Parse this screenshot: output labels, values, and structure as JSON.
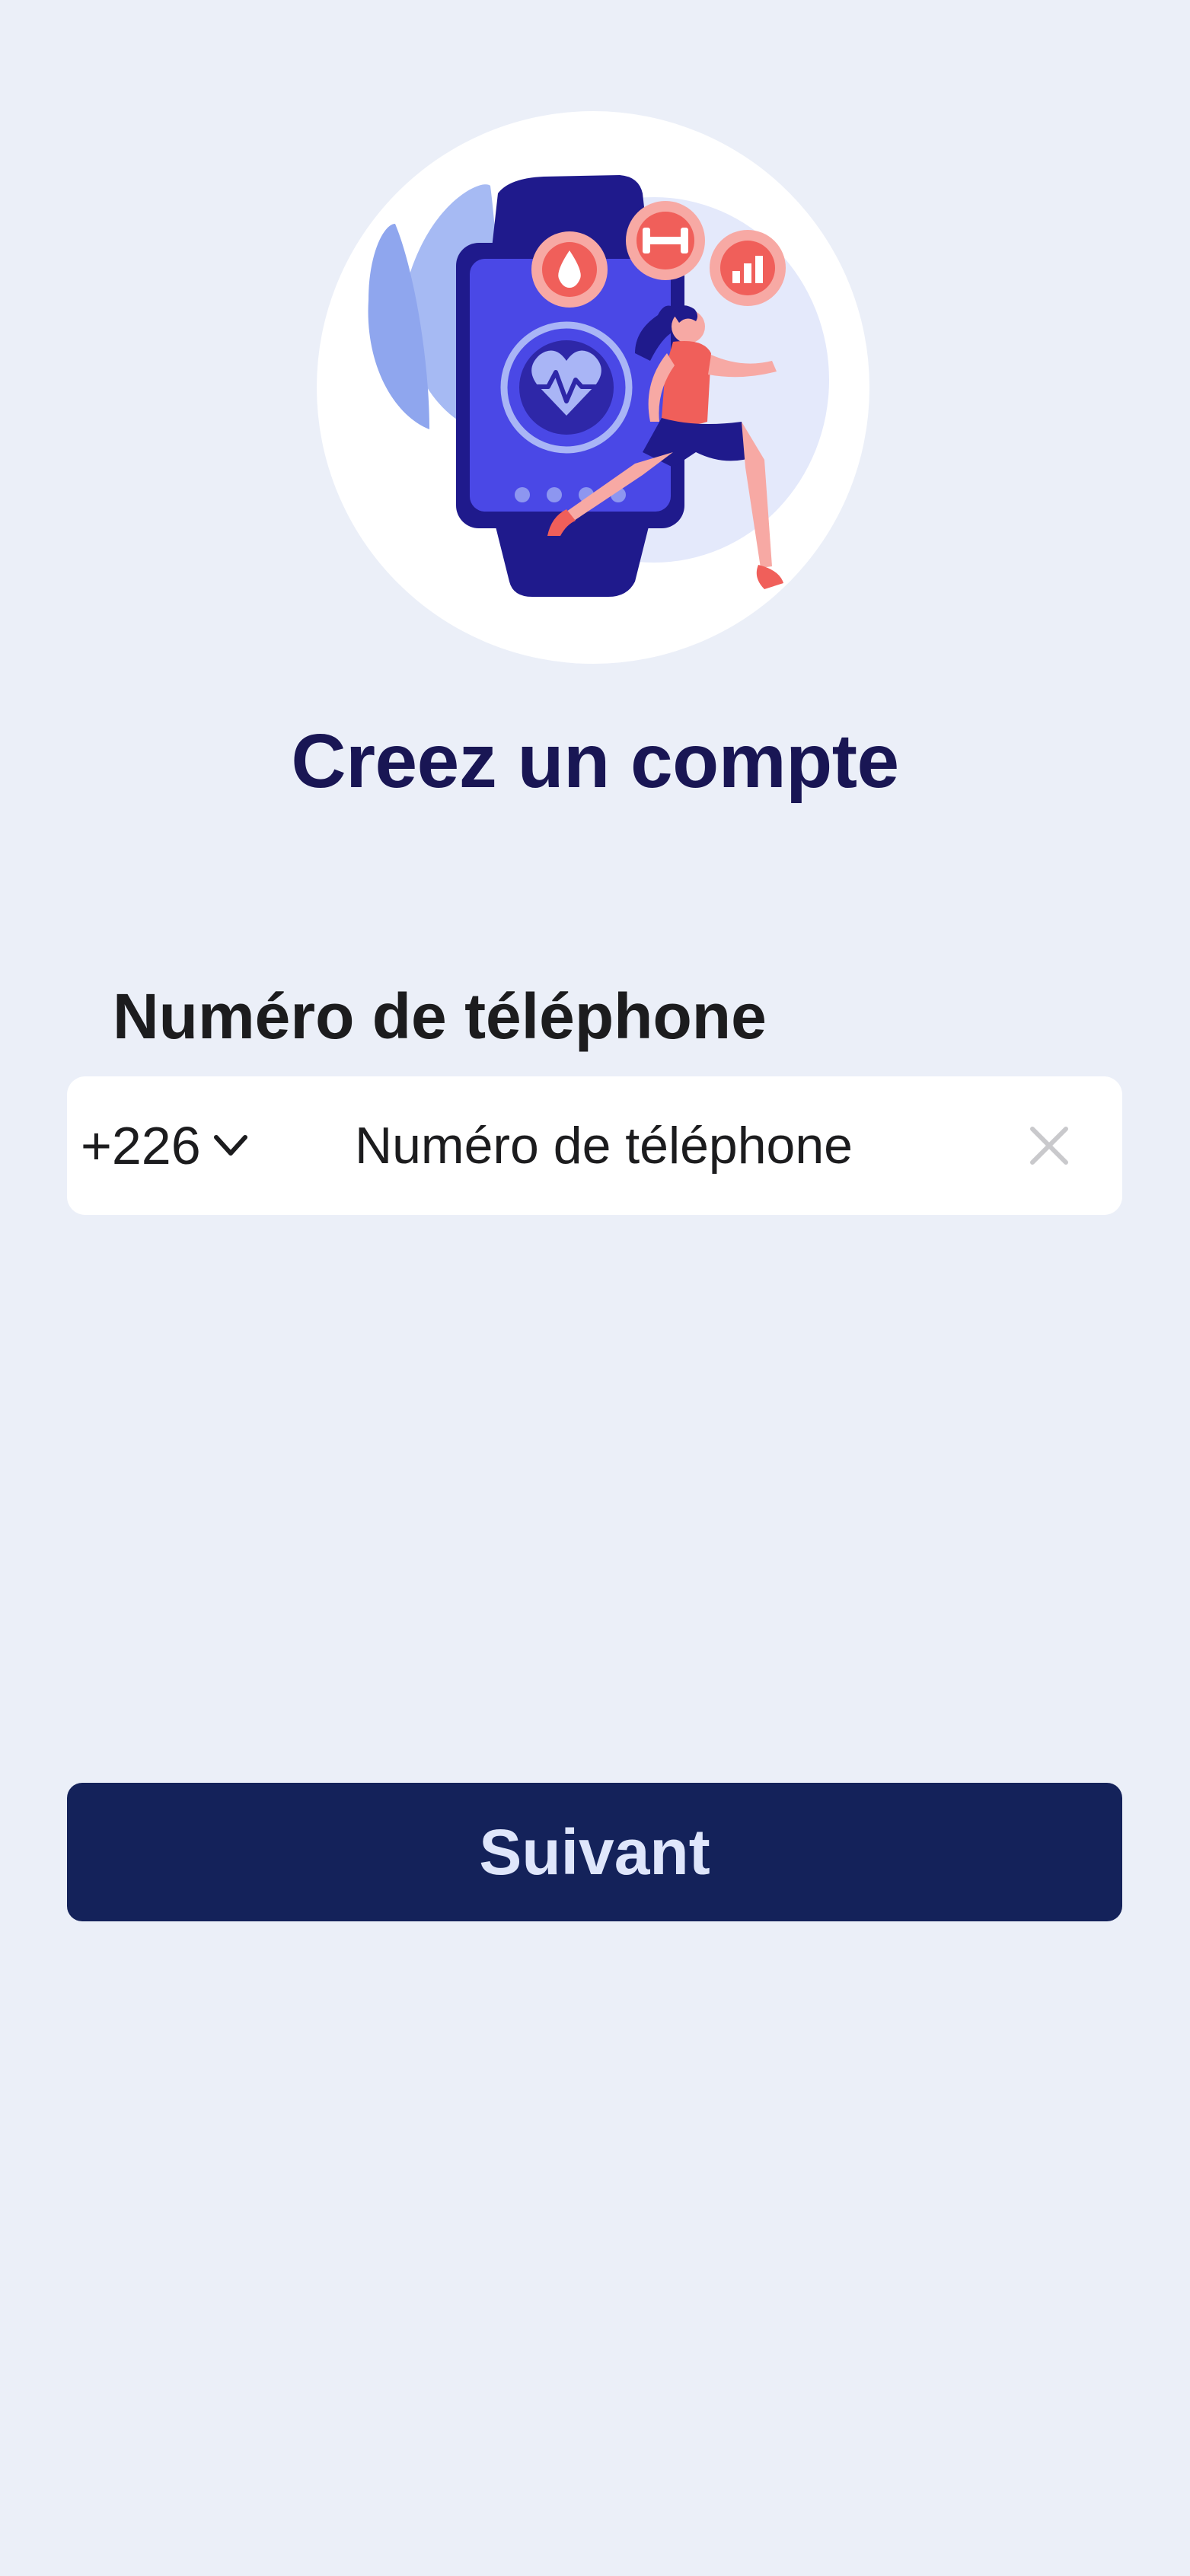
{
  "page": {
    "title": "Creez un compte",
    "background": "#ebeff8"
  },
  "illustration": {
    "icon": "smartwatch-fitness-illustration",
    "description_icons": [
      "water-drop-icon",
      "dumbbell-icon",
      "bar-chart-icon",
      "heart-rate-icon"
    ]
  },
  "phone": {
    "label": "Numéro de téléphone",
    "country_code": "+226",
    "placeholder": "Numéro de téléphone",
    "value": ""
  },
  "actions": {
    "next_label": "Suivant",
    "next_color": "#14225a"
  }
}
